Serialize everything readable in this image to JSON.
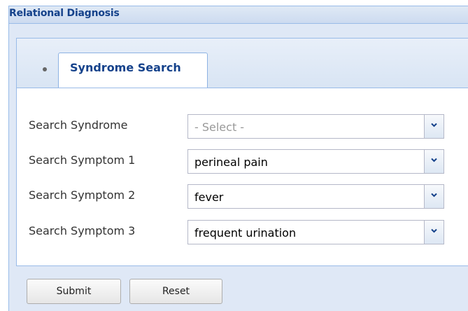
{
  "panel": {
    "title": "Relational Diagnosis"
  },
  "tabs": [
    {
      "label": "Syndrome Search",
      "active": true
    }
  ],
  "form": {
    "fields": [
      {
        "label": "Search Syndrome",
        "value": "- Select -",
        "is_placeholder": true
      },
      {
        "label": "Search Symptom 1",
        "value": "perineal pain",
        "is_placeholder": false
      },
      {
        "label": "Search Symptom 2",
        "value": "fever",
        "is_placeholder": false
      },
      {
        "label": "Search Symptom 3",
        "value": "frequent urination",
        "is_placeholder": false
      }
    ]
  },
  "buttons": {
    "submit_label": "Submit",
    "reset_label": "Reset"
  },
  "colors": {
    "title": "#15428b",
    "border": "#99bbe8",
    "panel_bg": "#dfe8f6"
  },
  "icons": {
    "dropdown": "chevron-down-icon",
    "tab_bullet": "bullet-icon"
  }
}
